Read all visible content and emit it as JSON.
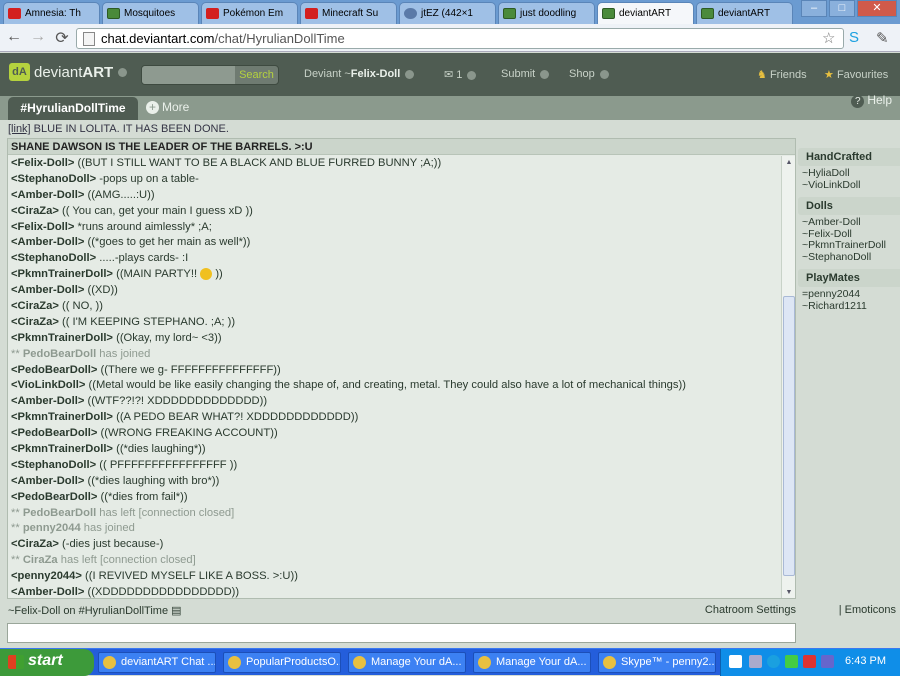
{
  "browser": {
    "tabs": [
      {
        "title": "Amnesia: Th",
        "icon": "youtube-icon"
      },
      {
        "title": "Mosquitoes",
        "icon": "deviantart-icon"
      },
      {
        "title": "Pokémon Em",
        "icon": "youtube-icon"
      },
      {
        "title": "Minecraft Su",
        "icon": "youtube-icon"
      },
      {
        "title": "jtEZ (442×1",
        "icon": "globe-icon"
      },
      {
        "title": "just doodling",
        "icon": "deviantart-icon"
      },
      {
        "title": "deviantART",
        "icon": "deviantart-icon",
        "active": true
      },
      {
        "title": "deviantART",
        "icon": "deviantart-icon"
      }
    ],
    "url_host": "chat.deviantart.com",
    "url_path": "/chat/HyrulianDollTime"
  },
  "header": {
    "logo_text_1": "deviant",
    "logo_text_2": "ART",
    "search_button": "Search",
    "user_prefix": "Deviant ~",
    "user_name": "Felix-Doll",
    "messages_count": "1",
    "submit": "Submit",
    "shop": "Shop",
    "friends": "Friends",
    "favourites": "Favourites"
  },
  "room": {
    "tab_label": "#HyrulianDollTime",
    "more": "More",
    "help": "Help",
    "topic_link": "[link]",
    "topic_text": " BLUE IN LOLITA. IT HAS BEEN DONE.",
    "title": "SHANE DAWSON IS THE LEADER OF THE BARRELS. >:U"
  },
  "messages": [
    {
      "nick": "<Felix-Doll>",
      "text": "  ((BUT I STILL WANT TO BE A BLACK AND BLUE FURRED BUNNY ;A;))"
    },
    {
      "nick": "<StephanoDoll>",
      "text": "  -pops up on a table-"
    },
    {
      "nick": "<Amber-Doll>",
      "text": "  ((AMG.....:U))"
    },
    {
      "nick": "<CiraZa>",
      "text": "  (( You can, get your main I guess xD ))"
    },
    {
      "nick": "<Felix-Doll>",
      "text": "  *runs around aimlessly* ;A;"
    },
    {
      "nick": "<Amber-Doll>",
      "text": "  ((*goes to get her main as well*))"
    },
    {
      "nick": "<StephanoDoll>",
      "text": "  .....-plays cards- :I"
    },
    {
      "nick": "<PkmnTrainerDoll>",
      "text": "  ((MAIN PARTY!! ",
      "emoticon": true,
      "text2": " ))"
    },
    {
      "nick": "<Amber-Doll>",
      "text": "  ((XD))"
    },
    {
      "nick": "<CiraZa>",
      "text": "  (( NO, ))"
    },
    {
      "nick": "<CiraZa>",
      "text": "  (( I'M KEEPING STEPHANO. ;A; ))"
    },
    {
      "nick": "<PkmnTrainerDoll>",
      "text": "  ((Okay, my lord~ <3))"
    },
    {
      "system": true,
      "prefix": "** ",
      "nick": "PedoBearDoll",
      "text": "  has joined"
    },
    {
      "nick": "<PedoBearDoll>",
      "text": "  ((There we g- FFFFFFFFFFFFFFF))"
    },
    {
      "nick": "<VioLinkDoll>",
      "text": "  ((Metal would be like easily changing the shape of, and creating, metal. They could also have a lot of mechanical things))"
    },
    {
      "nick": "<Amber-Doll>",
      "text": "  ((WTF??!?! XDDDDDDDDDDDDD))"
    },
    {
      "nick": "<PkmnTrainerDoll>",
      "text": "  ((A PEDO BEAR WHAT?! XDDDDDDDDDDDD))"
    },
    {
      "nick": "<PedoBearDoll>",
      "text": "  ((WRONG FREAKING ACCOUNT))"
    },
    {
      "nick": "<PkmnTrainerDoll>",
      "text": "  ((*dies laughing*))"
    },
    {
      "nick": "<StephanoDoll>",
      "text": "  (( PFFFFFFFFFFFFFFFF ))"
    },
    {
      "nick": "<Amber-Doll>",
      "text": "  ((*dies laughing with bro*))"
    },
    {
      "nick": "<PedoBearDoll>",
      "text": "  ((*dies from fail*))"
    },
    {
      "system": true,
      "prefix": "** ",
      "nick": "PedoBearDoll",
      "text": "  has left [connection closed]"
    },
    {
      "system": true,
      "prefix": "** ",
      "nick": "penny2044",
      "text": "  has joined"
    },
    {
      "nick": "<CiraZa>",
      "text": "  (-dies just because-)"
    },
    {
      "system": true,
      "prefix": "** ",
      "nick": "CiraZa",
      "text": "  has left [connection closed]"
    },
    {
      "nick": "<penny2044>",
      "text": "  ((I REVIVED MYSELF LIKE A BOSS. >:U))"
    },
    {
      "nick": "<Amber-Doll>",
      "text": "  ((XDDDDDDDDDDDDDDDD))"
    }
  ],
  "members": [
    {
      "group": "HandCrafted",
      "names": [
        "~HyliaDoll",
        "~VioLinkDoll"
      ]
    },
    {
      "group": "Dolls",
      "names": [
        "~Amber-Doll",
        "~Felix-Doll",
        "~PkmnTrainerDoll",
        "~StephanoDoll"
      ]
    },
    {
      "group": "PlayMates",
      "names": [
        "=penny2044",
        "~Richard1211"
      ]
    }
  ],
  "status": {
    "left": "~Felix-Doll on #HyrulianDollTime",
    "settings": "Chatroom Settings",
    "sep": "|",
    "emoticons": "Emoticons"
  },
  "taskbar": {
    "start": "start",
    "items": [
      "deviantART Chat ...",
      "PopularProductsO...",
      "Manage Your dA...",
      "Manage Your dA...",
      "Skype™ - penny2..."
    ],
    "clock": "6:43 PM"
  },
  "colors": {
    "brand_green": "#b5d23e",
    "header_bg": "#4f5c52"
  }
}
